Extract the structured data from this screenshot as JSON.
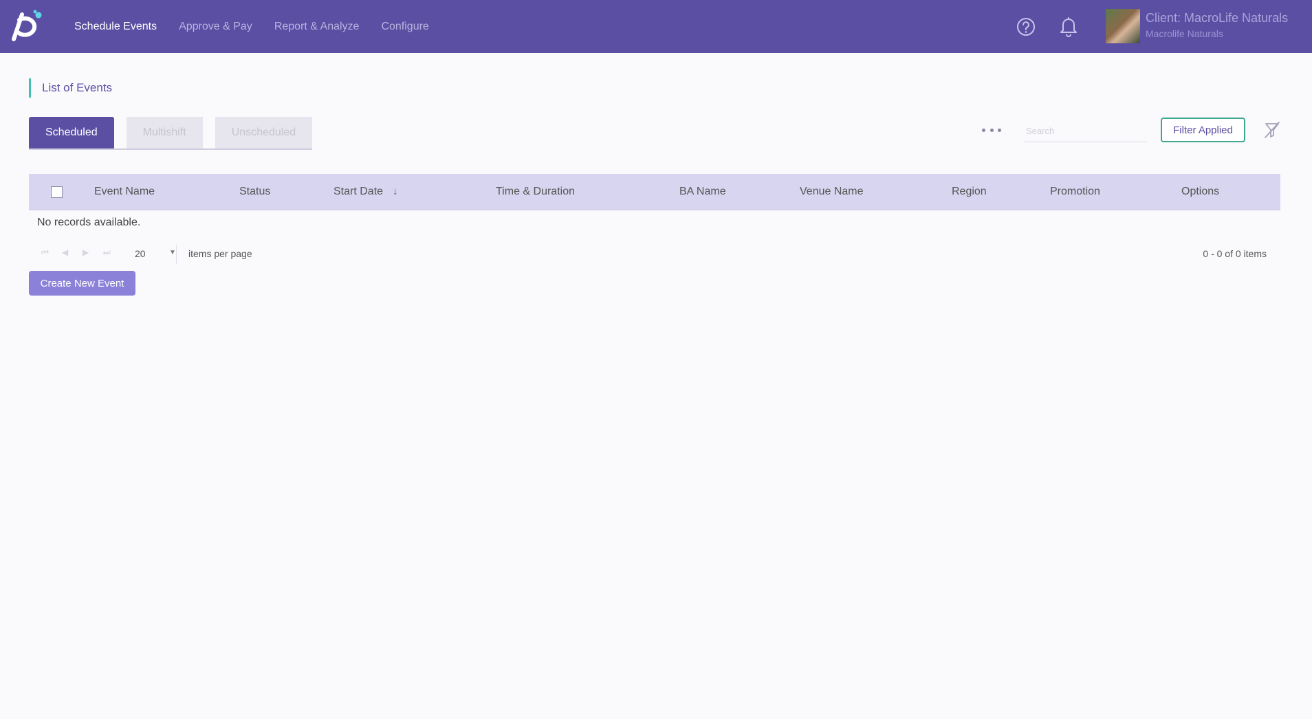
{
  "nav": {
    "items": [
      {
        "label": "Schedule Events",
        "active": true
      },
      {
        "label": "Approve & Pay",
        "active": false
      },
      {
        "label": "Report & Analyze",
        "active": false
      },
      {
        "label": "Configure",
        "active": false
      }
    ]
  },
  "client": {
    "title": "Client: MacroLife Naturals",
    "subtitle": "Macrolife Naturals"
  },
  "page": {
    "title": "List of Events"
  },
  "tabs": [
    {
      "label": "Scheduled",
      "active": true
    },
    {
      "label": "Multishift",
      "active": false
    },
    {
      "label": "Unscheduled",
      "active": false
    }
  ],
  "toolbar": {
    "search_placeholder": "Search",
    "filter_label": "Filter Applied"
  },
  "table": {
    "columns": [
      "Event Name",
      "Status",
      "Start Date",
      "Time & Duration",
      "BA Name",
      "Venue Name",
      "Region",
      "Promotion",
      "Options"
    ],
    "sort_arrow": "↓",
    "empty_text": "No records available."
  },
  "pager": {
    "page_size": "20",
    "items_per_page_label": "items per page",
    "range_label": "0 - 0 of 0 items"
  },
  "actions": {
    "create_label": "Create New Event"
  },
  "colors": {
    "brand": "#5b4fa3",
    "accent": "#3fc1b0",
    "filter_border": "#3fa690",
    "header_row": "#d8d5f1",
    "create_button": "#8c81d8"
  }
}
